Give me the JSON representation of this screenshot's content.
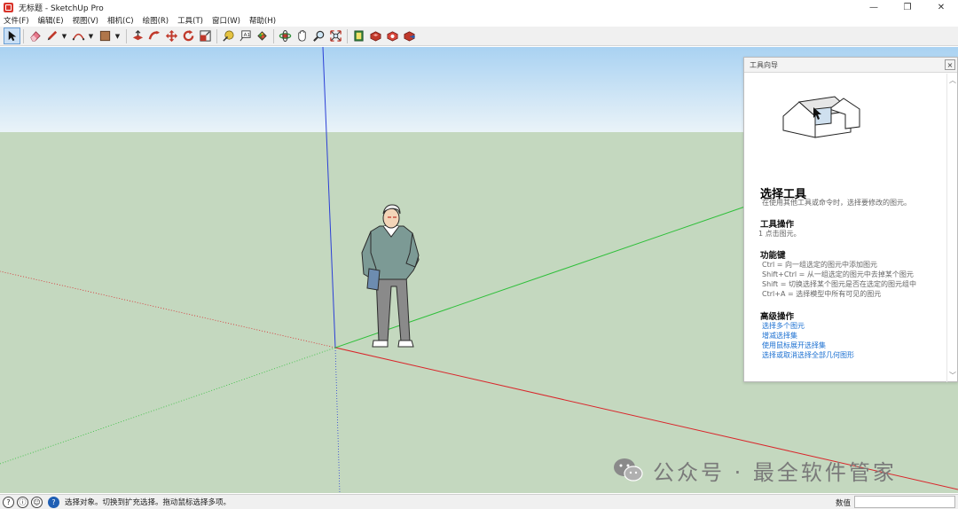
{
  "window": {
    "title": "无标题 - SketchUp Pro",
    "minimize": "—",
    "maximize": "❐",
    "close": "✕"
  },
  "menu": [
    "文件(F)",
    "编辑(E)",
    "视图(V)",
    "相机(C)",
    "绘图(R)",
    "工具(T)",
    "窗口(W)",
    "帮助(H)"
  ],
  "toolbar": {
    "icons": [
      "select-icon",
      "eraser-icon",
      "pencil-icon",
      "arc-icon",
      "rectangle-icon",
      "push-pull-icon",
      "follow-me-icon",
      "move-icon",
      "rotate-icon",
      "scale-icon",
      "tape-measure-icon",
      "text-icon",
      "paint-bucket-icon",
      "orbit-icon",
      "pan-icon",
      "zoom-icon",
      "zoom-extents-icon",
      "warehouse-icon",
      "extension-icon",
      "extension-manager-icon",
      "share-icon"
    ],
    "dropdown_arrow": "▼"
  },
  "instructor": {
    "title": "工具向导",
    "close": "×",
    "scroll_up": "︿",
    "scroll_down": "﹀",
    "tool_name": "选择工具",
    "tool_desc": "在使用其他工具或命令时，选择要修改的图元。",
    "ops_heading": "工具操作",
    "ops": [
      "1    点击图元。"
    ],
    "keys_heading": "功能键",
    "keys": [
      "Ctrl = 向一组选定的图元中添加图元",
      "Shift+Ctrl = 从一组选定的图元中去掉某个图元",
      "Shift = 切换选择某个图元是否在选定的图元组中",
      "Ctrl+A = 选择模型中所有可见的图元"
    ],
    "advanced_heading": "高级操作",
    "advanced_links": [
      "选择多个图元",
      "增减选择集",
      "使用鼠标展开选择集",
      "选择或取消选择全部几何图形"
    ]
  },
  "status": {
    "icons": [
      "geo-location-icon",
      "credits-icon",
      "user-icon",
      "help-icon"
    ],
    "icon_glyphs": [
      "?",
      "ⓘ",
      "☺",
      "?"
    ],
    "message": "选择对象。切换到扩充选择。拖动鼠标选择多项。",
    "measurements_label": "数值",
    "measurements_value": ""
  },
  "watermark": {
    "text": "公众号 · 最全软件管家"
  },
  "colors": {
    "sky_top": "#a9d2f2",
    "sky_bottom": "#e8f2f8",
    "ground": "#c4d8bf",
    "axis_red": "#d9262b",
    "axis_green": "#2fbf3a",
    "axis_blue": "#2b3fd6",
    "link": "#1a6fd1"
  }
}
